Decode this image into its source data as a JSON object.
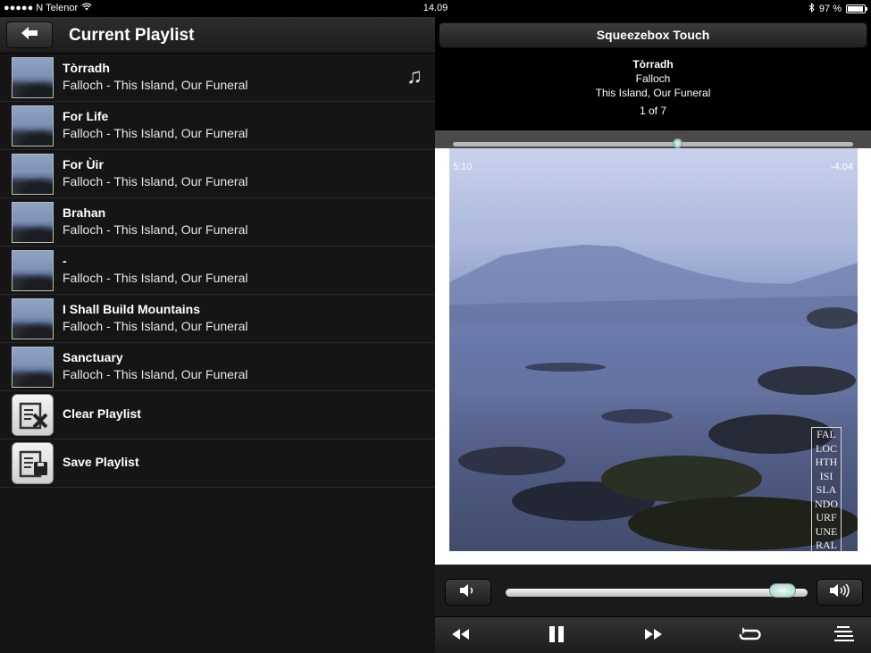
{
  "status_bar": {
    "carrier": "●●●●● N Telenor",
    "time": "14.09",
    "battery": "97 %",
    "battery_level": 0.97,
    "icons": [
      "wifi-icon",
      "bluetooth-icon",
      "battery-icon"
    ]
  },
  "playlist": {
    "title": "Current Playlist",
    "tracks": [
      {
        "title": "Tòrradh",
        "subtitle": "Falloch - This Island, Our Funeral",
        "playing": true
      },
      {
        "title": "For Life",
        "subtitle": "Falloch - This Island, Our Funeral"
      },
      {
        "title": "For Ùir",
        "subtitle": "Falloch - This Island, Our Funeral"
      },
      {
        "title": "Brahan",
        "subtitle": "Falloch - This Island, Our Funeral"
      },
      {
        "title": "-",
        "subtitle": "Falloch - This Island, Our Funeral"
      },
      {
        "title": "I Shall Build Mountains",
        "subtitle": "Falloch - This Island, Our Funeral"
      },
      {
        "title": "Sanctuary",
        "subtitle": "Falloch - This Island, Our Funeral"
      }
    ],
    "actions": [
      {
        "label": "Clear Playlist",
        "icon": "clear-playlist-icon"
      },
      {
        "label": "Save Playlist",
        "icon": "save-playlist-icon"
      }
    ]
  },
  "now_playing": {
    "player_name": "Squeezebox Touch",
    "track": "Tòrradh",
    "artist": "Falloch",
    "album": "This Island, Our Funeral",
    "position": "1 of 7",
    "elapsed": "5:10",
    "remaining": "-4:04",
    "progress": 0.56,
    "volume": 0.96,
    "album_art_text": [
      "FAL",
      "LOC",
      "HTH",
      "ISI",
      "SLA",
      "NDO",
      "URF",
      "UNE",
      "RAL"
    ]
  },
  "colors": {
    "accent_knob": "#9fd0c8",
    "panel_bg": "#141414"
  }
}
